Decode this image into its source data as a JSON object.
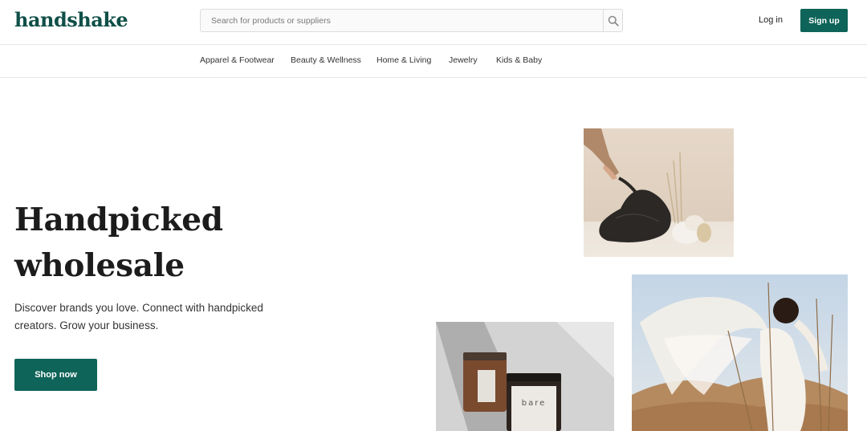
{
  "header": {
    "logo": "handshake",
    "search": {
      "placeholder": "Search for products or suppliers",
      "value": ""
    },
    "login_label": "Log in",
    "signup_label": "Sign up"
  },
  "categories": [
    "Apparel & Footwear",
    "Beauty & Wellness",
    "Home & Living",
    "Jewelry",
    "Kids & Baby"
  ],
  "hero": {
    "title_line1": "Handpicked",
    "title_line2": "wholesale",
    "subtitle": "Discover brands you love. Connect with handpicked creators. Grow your business.",
    "cta_label": "Shop now"
  },
  "images": {
    "candle_label": "bare"
  },
  "icons": {
    "search": "search-icon"
  },
  "colors": {
    "brand": "#0e6458",
    "logo": "#0f4f47"
  }
}
